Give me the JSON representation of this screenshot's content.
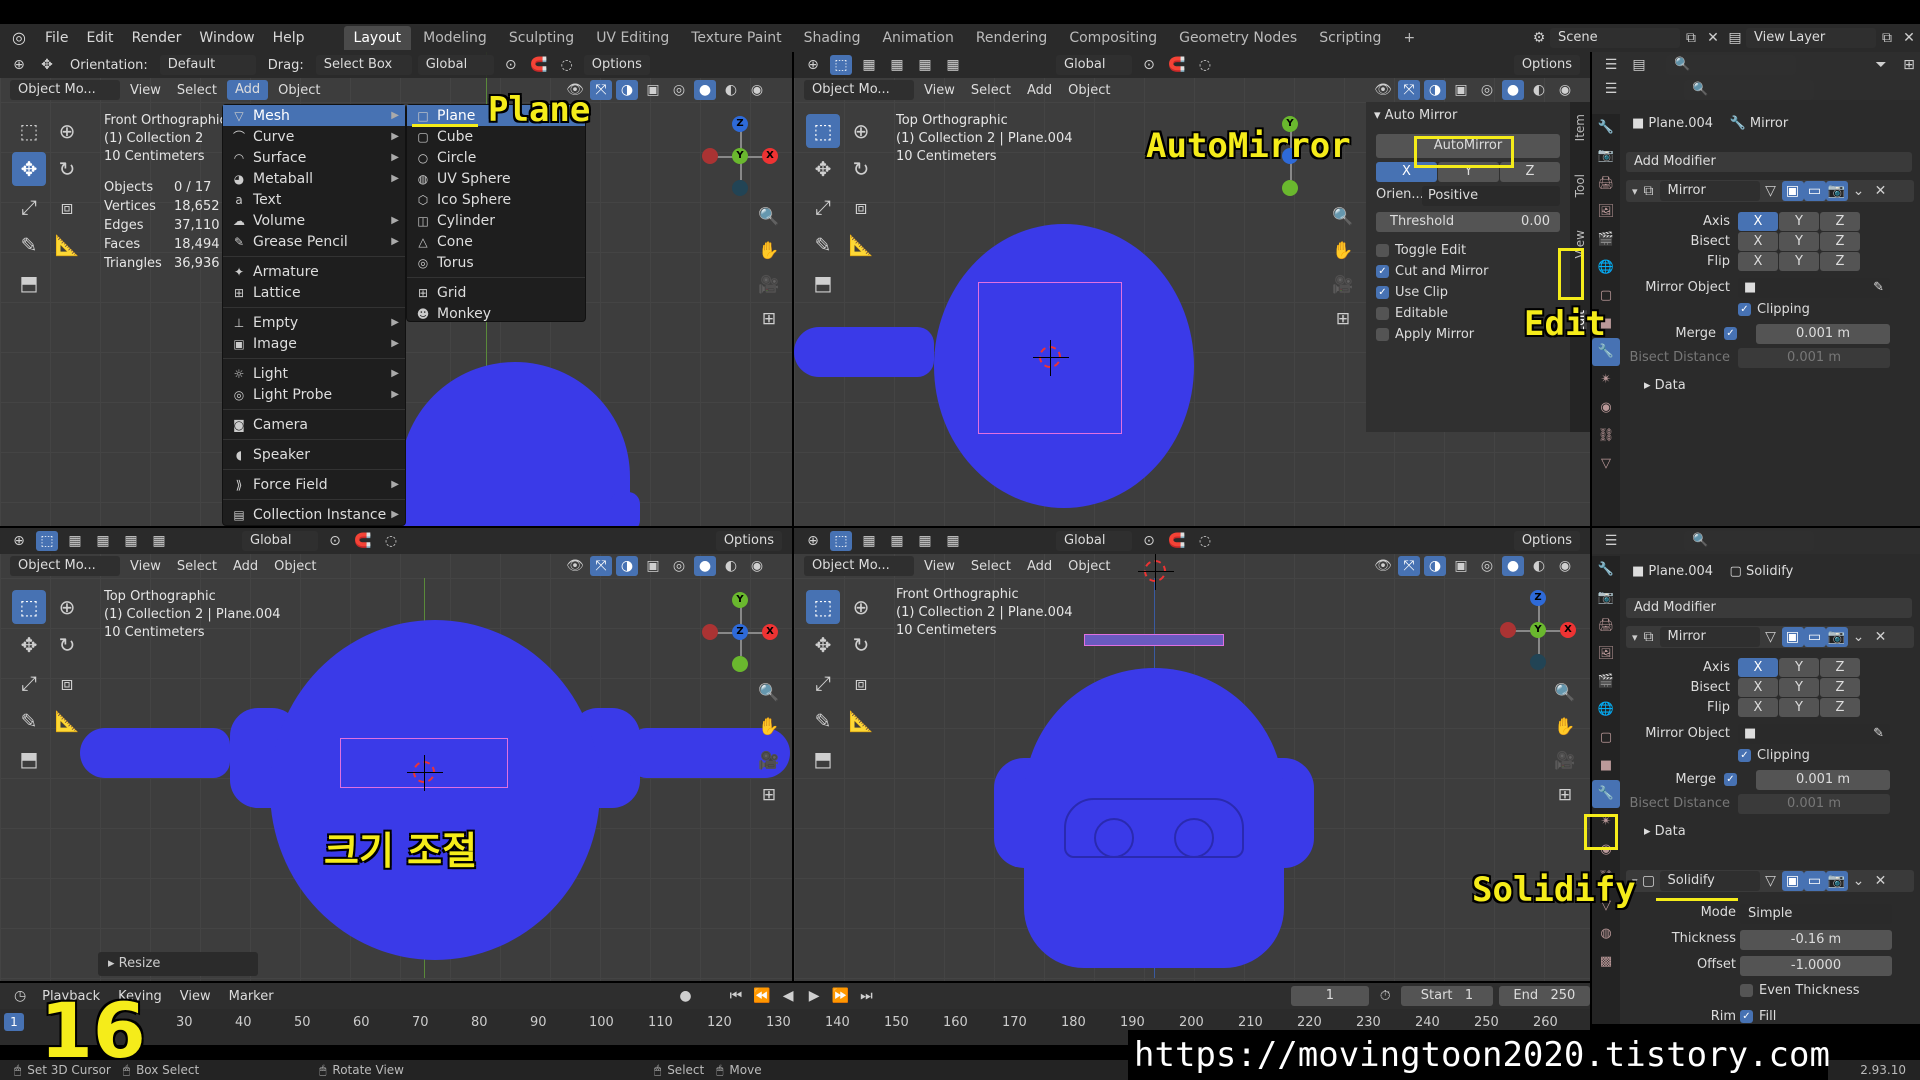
{
  "topbar": {
    "menus": [
      "File",
      "Edit",
      "Render",
      "Window",
      "Help"
    ],
    "workspaces": [
      "Layout",
      "Modeling",
      "Sculpting",
      "UV Editing",
      "Texture Paint",
      "Shading",
      "Animation",
      "Rendering",
      "Compositing",
      "Geometry Nodes",
      "Scripting"
    ],
    "active_workspace": "Layout",
    "scene": "Scene",
    "view_layer": "View Layer"
  },
  "tool_header": {
    "orientation_label": "Orientation:",
    "orientation_value": "Default",
    "drag_label": "Drag:",
    "drag_value": "Select Box",
    "transform": "Global",
    "options": "Options"
  },
  "viewport_menus": {
    "mode": "Object Mo...",
    "view": "View",
    "select": "Select",
    "add": "Add",
    "object": "Object"
  },
  "vp1": {
    "view_name": "Front Orthographic",
    "collection": "(1) Collection 2",
    "scale": "10 Centimeters",
    "stats": [
      {
        "label": "Objects",
        "value": "0 / 17"
      },
      {
        "label": "Vertices",
        "value": "18,652"
      },
      {
        "label": "Edges",
        "value": "37,110"
      },
      {
        "label": "Faces",
        "value": "18,494"
      },
      {
        "label": "Triangles",
        "value": "36,936"
      }
    ]
  },
  "vp2": {
    "view_name": "Top Orthographic",
    "collection": "(1) Collection 2 | Plane.004",
    "scale": "10 Centimeters",
    "options": "Options",
    "transform": "Global"
  },
  "vp3": {
    "view_name": "Top Orthographic",
    "collection": "(1) Collection 2 | Plane.004",
    "scale": "10 Centimeters",
    "options": "Options",
    "transform": "Global",
    "resize_label": "Resize"
  },
  "vp4": {
    "view_name": "Front Orthographic",
    "collection": "(1) Collection 2 | Plane.004",
    "scale": "10 Centimeters",
    "options": "Options",
    "transform": "Global"
  },
  "add_menu": {
    "items": [
      {
        "label": "Mesh",
        "icon": "▽",
        "sub": true
      },
      {
        "label": "Curve",
        "icon": "⌒",
        "sub": true
      },
      {
        "label": "Surface",
        "icon": "◠",
        "sub": true
      },
      {
        "label": "Metaball",
        "icon": "◕",
        "sub": true
      },
      {
        "label": "Text",
        "icon": "a",
        "sub": false
      },
      {
        "label": "Volume",
        "icon": "☁",
        "sub": true
      },
      {
        "label": "Grease Pencil",
        "icon": "✎",
        "sub": true
      },
      {
        "label": "Armature",
        "icon": "✦",
        "sub": false
      },
      {
        "label": "Lattice",
        "icon": "⊞",
        "sub": false
      },
      {
        "label": "Empty",
        "icon": "⊥",
        "sub": true
      },
      {
        "label": "Image",
        "icon": "▣",
        "sub": true
      },
      {
        "label": "Light",
        "icon": "☼",
        "sub": true
      },
      {
        "label": "Light Probe",
        "icon": "◎",
        "sub": true
      },
      {
        "label": "Camera",
        "icon": "◙",
        "sub": false
      },
      {
        "label": "Speaker",
        "icon": "◖",
        "sub": false
      },
      {
        "label": "Force Field",
        "icon": "⟫",
        "sub": true
      },
      {
        "label": "Collection Instance",
        "icon": "▤",
        "sub": true
      }
    ]
  },
  "mesh_submenu": {
    "items": [
      {
        "label": "Plane",
        "icon": "□"
      },
      {
        "label": "Cube",
        "icon": "▢"
      },
      {
        "label": "Circle",
        "icon": "○"
      },
      {
        "label": "UV Sphere",
        "icon": "◍"
      },
      {
        "label": "Ico Sphere",
        "icon": "⬡"
      },
      {
        "label": "Cylinder",
        "icon": "◫"
      },
      {
        "label": "Cone",
        "icon": "△"
      },
      {
        "label": "Torus",
        "icon": "◎"
      },
      {
        "label": "Grid",
        "icon": "⊞"
      },
      {
        "label": "Monkey",
        "icon": "☻"
      }
    ]
  },
  "automirror": {
    "panel_title": "Auto Mirror",
    "button": "AutoMirror",
    "axes": [
      "X",
      "Y",
      "Z"
    ],
    "orientation_label": "Orien...",
    "orientation_value": "Positive",
    "threshold_label": "Threshold",
    "threshold_value": "0.00",
    "checks": [
      {
        "label": "Toggle Edit",
        "on": false
      },
      {
        "label": "Cut and Mirror",
        "on": true
      },
      {
        "label": "Use Clip",
        "on": true
      },
      {
        "label": "Editable",
        "on": false
      },
      {
        "label": "Apply Mirror",
        "on": false
      }
    ],
    "side_tabs": [
      "Item",
      "Tool",
      "View",
      "Edit"
    ]
  },
  "props_top": {
    "object": "Plane.004",
    "modifier_crumb": "Mirror",
    "add_modifier": "Add Modifier",
    "mirror": {
      "name": "Mirror",
      "axis_label": "Axis",
      "bisect_label": "Bisect",
      "flip_label": "Flip",
      "xyz": [
        "X",
        "Y",
        "Z"
      ],
      "mirror_object_label": "Mirror Object",
      "clipping": "Clipping",
      "merge_label": "Merge",
      "merge_value": "0.001 m",
      "bisect_distance_label": "Bisect Distance",
      "bisect_distance_value": "0.001 m",
      "data": "Data"
    }
  },
  "props_bottom": {
    "object": "Plane.004",
    "modifier_crumb": "Solidify",
    "add_modifier": "Add Modifier",
    "mirror": {
      "name": "Mirror",
      "axis_label": "Axis",
      "bisect_label": "Bisect",
      "flip_label": "Flip",
      "xyz": [
        "X",
        "Y",
        "Z"
      ],
      "mirror_object_label": "Mirror Object",
      "clipping": "Clipping",
      "merge_label": "Merge",
      "merge_value": "0.001 m",
      "bisect_distance_label": "Bisect Distance",
      "bisect_distance_value": "0.001 m",
      "data": "Data"
    },
    "solidify": {
      "name": "Solidify",
      "mode_label": "Mode",
      "mode_value": "Simple",
      "thickness_label": "Thickness",
      "thickness_value": "-0.16 m",
      "offset_label": "Offset",
      "offset_value": "-1.0000",
      "even_thickness": "Even Thickness",
      "rim_label": "Rim",
      "fill": "Fill"
    }
  },
  "timeline": {
    "playback": "Playback",
    "keying": "Keying",
    "view": "View",
    "marker": "Marker",
    "current_frame": "1",
    "start_label": "Start",
    "start_value": "1",
    "end_label": "End",
    "end_value": "250",
    "ticks": [
      "0",
      "30",
      "40",
      "50",
      "60",
      "70",
      "80",
      "90",
      "100",
      "110",
      "120",
      "130",
      "140",
      "150",
      "160",
      "170",
      "180",
      "190",
      "200",
      "210",
      "220",
      "230",
      "240",
      "250",
      "260"
    ],
    "frame_marker": "1"
  },
  "statusbar": {
    "items": [
      "Set 3D Cursor",
      "Box Select",
      "Rotate View",
      "Select",
      "Move"
    ],
    "version": "2.93.10"
  },
  "annotations": {
    "plane": "Plane",
    "automirror": "AutoMirror",
    "edit": "Edit",
    "resize": "크기 조절",
    "solidify": "Solidify",
    "step": "16",
    "url": "https://movingtoon2020.tistory.com"
  },
  "colors": {
    "mesh_blue": "#3a3ae8",
    "accent": "#4772b3",
    "annotation": "#f5ec1a"
  }
}
